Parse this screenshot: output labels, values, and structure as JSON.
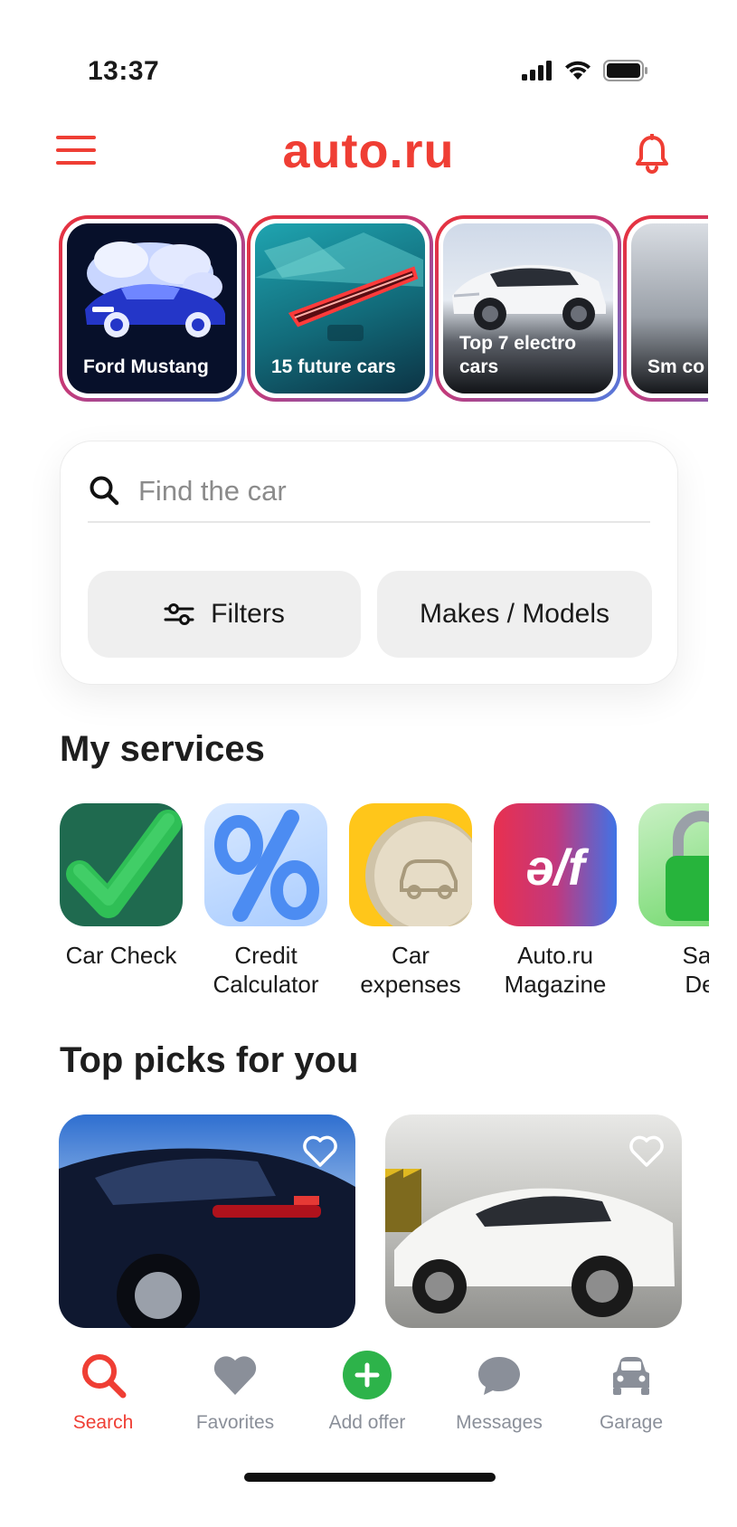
{
  "status_bar": {
    "time": "13:37"
  },
  "header": {
    "brand": "auto.ru"
  },
  "stories": [
    {
      "title": "Ford Mustang"
    },
    {
      "title": "15 future cars"
    },
    {
      "title": "Top 7 electro cars"
    },
    {
      "title": "Sm co"
    }
  ],
  "search": {
    "placeholder": "Find the car",
    "filters_label": "Filters",
    "makes_label": "Makes / Models"
  },
  "services": {
    "title": "My services",
    "items": [
      {
        "label_line1": "Car Check",
        "label_line2": ""
      },
      {
        "label_line1": "Credit",
        "label_line2": "Calculator"
      },
      {
        "label_line1": "Car",
        "label_line2": "expenses"
      },
      {
        "label_line1": "Auto.ru",
        "label_line2": "Magazine"
      },
      {
        "label_line1": "Saf",
        "label_line2": "De"
      }
    ],
    "magazine_logo_text": "ə/f"
  },
  "picks": {
    "title": "Top picks for you"
  },
  "tab_bar": {
    "items": [
      {
        "label": "Search"
      },
      {
        "label": "Favorites"
      },
      {
        "label": "Add offer"
      },
      {
        "label": "Messages"
      },
      {
        "label": "Garage"
      }
    ]
  },
  "colors": {
    "brand_red": "#ef3e34",
    "add_green": "#2db34a",
    "tab_inactive": "#8a8f99"
  }
}
